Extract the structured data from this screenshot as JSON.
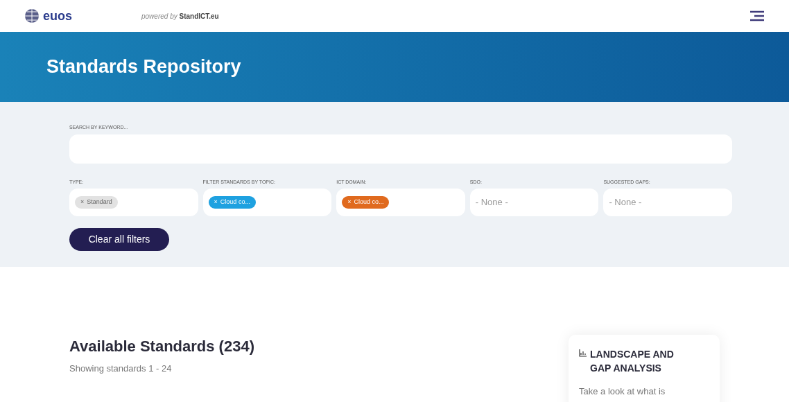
{
  "header": {
    "logo": "euos",
    "powered_by": "powered by",
    "powered_brand": "StandICT.eu"
  },
  "banner": {
    "title": "Standards Repository"
  },
  "search": {
    "label": "SEARCH BY KEYWORD..."
  },
  "filters": [
    {
      "label": "TYPE:",
      "kind": "tag",
      "remove": "×",
      "tag": "Standard",
      "color": "#e2e2e2"
    },
    {
      "label": "FILTER STANDARDS BY TOPIC:",
      "kind": "tag",
      "remove": "×",
      "tag": "Cloud co...",
      "color": "#1ea1e0"
    },
    {
      "label": "ICT DOMAIN:",
      "kind": "tag",
      "remove": "×",
      "tag": "Cloud co...",
      "color": "#e06a1e"
    },
    {
      "label": "SDO:",
      "kind": "none",
      "value": "- None -"
    },
    {
      "label": "SUGGESTED GAPS:",
      "kind": "none",
      "value": "- None -"
    }
  ],
  "clear_button": "Clear all filters",
  "results": {
    "title": "Available Standards (234)",
    "subtitle": "Showing standards 1 - 24"
  },
  "side_card": {
    "title": "LANDSCAPE AND GAP ANALYSIS",
    "text": "Take a look at what is"
  }
}
